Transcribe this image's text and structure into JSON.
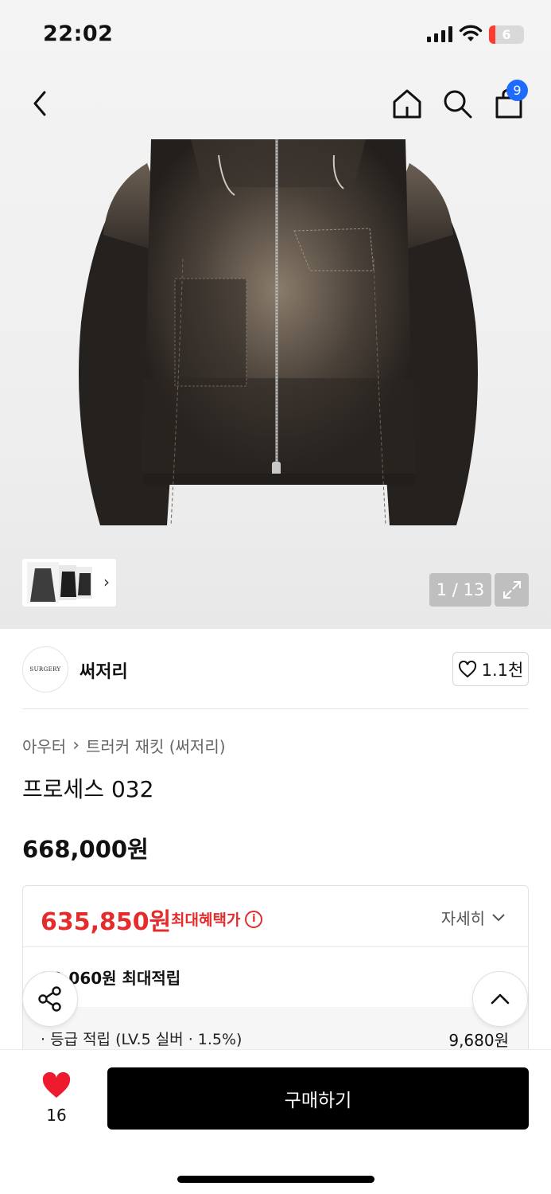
{
  "status_bar": {
    "time": "22:02",
    "battery": "6",
    "icons": [
      "signal-icon",
      "wifi-icon",
      "battery-icon"
    ]
  },
  "nav": {
    "cart_badge": "9",
    "icons": [
      "back-icon",
      "home-icon",
      "search-icon",
      "cart-icon"
    ]
  },
  "gallery": {
    "counter": "1 / 13",
    "icons": [
      "chevron-right-icon",
      "expand-icon"
    ]
  },
  "brand": {
    "logo_text": "SURGERY",
    "name": "써저리",
    "likes": "1.1천"
  },
  "breadcrumb": {
    "category": "아우터",
    "subcategory": "트러커 재킷 (써저리)"
  },
  "product": {
    "title": "프로세스 032",
    "price": "668,000원"
  },
  "benefit": {
    "sale_price": "635,850원",
    "sale_label": "최대혜택가",
    "detail_label": "자세히",
    "points_total": "30,060원 최대적립",
    "rows": [
      {
        "label": "· 등급 적립 (LV.5 실버 · 1.5%)",
        "value": "9,680원"
      }
    ]
  },
  "bottom": {
    "wish_count": "16",
    "buy_label": "구매하기"
  },
  "colors": {
    "sale_red": "#e52c2c",
    "badge_blue": "#1f6bff",
    "heart_red": "#ee1b2e"
  }
}
